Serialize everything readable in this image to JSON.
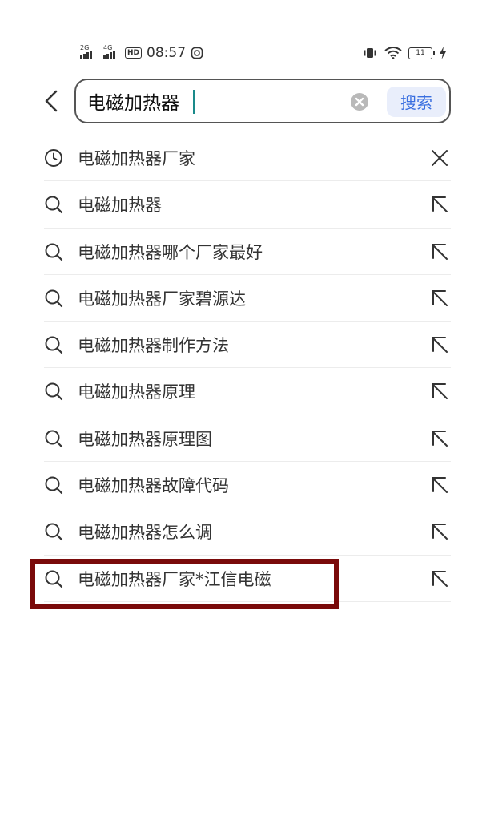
{
  "status": {
    "net1": "2G",
    "net2": "4G",
    "hd": "HD",
    "time": "08:57",
    "battery": "11"
  },
  "search": {
    "query": "电磁加热器",
    "button_label": "搜索"
  },
  "suggestions": [
    {
      "text": "电磁加热器厂家",
      "type": "history"
    },
    {
      "text": "电磁加热器",
      "type": "suggest"
    },
    {
      "text": "电磁加热器哪个厂家最好",
      "type": "suggest"
    },
    {
      "text": "电磁加热器厂家碧源达",
      "type": "suggest"
    },
    {
      "text": "电磁加热器制作方法",
      "type": "suggest"
    },
    {
      "text": "电磁加热器原理",
      "type": "suggest"
    },
    {
      "text": "电磁加热器原理图",
      "type": "suggest"
    },
    {
      "text": "电磁加热器故障代码",
      "type": "suggest"
    },
    {
      "text": "电磁加热器怎么调",
      "type": "suggest"
    },
    {
      "text": "电磁加热器厂家*江信电磁",
      "type": "suggest"
    }
  ],
  "colors": {
    "accent": "#3a6fe0",
    "highlight": "#7a0a0a"
  }
}
